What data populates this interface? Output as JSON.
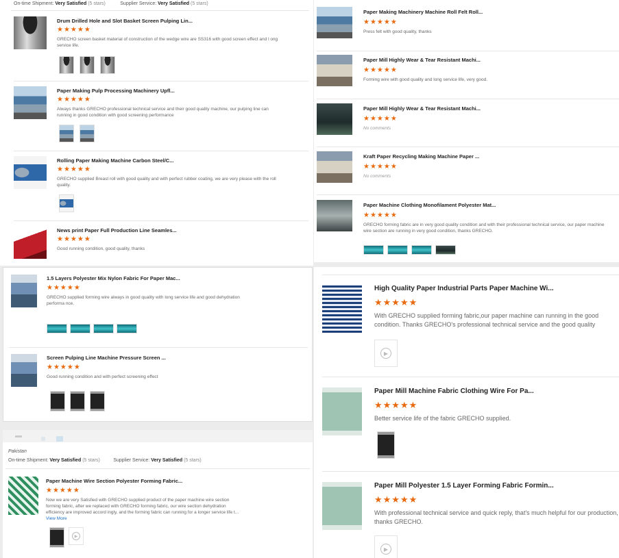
{
  "left_top": {
    "header": {
      "shipment_label": "On-time Shipment:",
      "shipment_value": "Very Satisfied",
      "shipment_stars": "(5 stars)",
      "service_label": "Supplier Service:",
      "service_value": "Very Satisfied",
      "service_stars": "(5 stars)"
    },
    "reviews": [
      {
        "title": "Drum Drilled Hole and Slot Basket Screen Pulping Lin...",
        "stars": "★★★★★",
        "text": "GRECHO screen basket material of construction of the wedge wire are SS316 with good screen effect and l ong service life.",
        "thumb_icon": "screen-basket-icon",
        "pics": [
          "basket-photo-icon",
          "basket-photo-icon",
          "basket-photo-icon"
        ]
      },
      {
        "title": "Paper Making Pulp Processing Machinery Upfl...",
        "stars": "★★★★★",
        "text": "Always thanks GRECHO professional technical service and their good quality machine, our pulping line can running in good condition with good screening performance",
        "thumb_icon": "pulping-machine-icon",
        "pics": [
          "machine-photo-icon",
          "machine-photo-icon"
        ]
      },
      {
        "title": "Rolling Paper Making Machine Carbon Steel/C...",
        "stars": "★★★★★",
        "text": "GRECHO supplied Breast roll with good quality and with perfect rubber coating, we are very please with the roll quality.",
        "thumb_icon": "breast-roll-icon",
        "pics": [
          "roll-photo-icon"
        ]
      },
      {
        "title": "News print Paper Full Production Line Seamles...",
        "stars": "★★★★★",
        "text": "Good running condition, good quality, thanks",
        "thumb_icon": "red-felt-icon",
        "pics": []
      }
    ]
  },
  "left_mid": {
    "reviews": [
      {
        "title": "1.5 Layers Polyester Mix Nylon Fabric For Paper Mac...",
        "stars": "★★★★★",
        "text": "GRECHO supplied forming wire always in good quality with long service life and good dehydration performa nce.",
        "thumb_icon": "forming-line-icon",
        "pics": [
          "fabric-photo-icon",
          "fabric-photo-icon",
          "fabric-photo-icon",
          "fabric-photo-icon"
        ]
      },
      {
        "title": "Screen Pulping Line Machine Pressure Screen ...",
        "stars": "★★★★★",
        "text": "Good running condition and with perfect screening effect",
        "thumb_icon": "pressure-screen-icon",
        "pics": [
          "screen-photo-icon",
          "screen-photo-icon",
          "screen-photo-icon"
        ]
      }
    ]
  },
  "left_bottom": {
    "country": "Pakistan",
    "header": {
      "shipment_label": "On-time Shipment:",
      "shipment_value": "Very Satisfied",
      "shipment_stars": "(5 stars)",
      "service_label": "Supplier Service:",
      "service_value": "Very Satisfied",
      "service_stars": "(5 stars)"
    },
    "review": {
      "title": "Paper Machine Wire Section Polyester Forming Fabric...",
      "stars": "★★★★★",
      "text": "Now we are very Satisfied with GRECHO supplied product of the paper machine wire section forming fabric, after we replaced with GRECHO forming fabric, our wire section dehydration efficiency are improved accord ingly, and the forming fabric can  running for a longer service life t...",
      "more": "View More",
      "thumb_icon": "forming-fabric-icon",
      "pics": [
        "wire-photo-icon"
      ],
      "play_icon": "play-icon"
    }
  },
  "right_top": {
    "reviews": [
      {
        "title": "Paper Making Machinery Machine Roll Felt Roll...",
        "stars": "★★★★★",
        "text": "Press felt with good quality, thanks",
        "thumb_icon": "press-felt-icon"
      },
      {
        "title": "Paper Mill Highly Wear & Tear Resistant Machi...",
        "stars": "★★★★★",
        "text": "Forming wire with good quality and long service life, very good.",
        "thumb_icon": "felt-roll-icon"
      },
      {
        "title": "Paper Mill Highly Wear & Tear Resistant Machi...",
        "stars": "★★★★★",
        "text": "No comments",
        "thumb_icon": "mill-hall-icon"
      },
      {
        "title": "Kraft Paper Recycling Making Machine Paper ...",
        "stars": "★★★★★",
        "text": "No comments",
        "thumb_icon": "paper-machine-icon"
      },
      {
        "title": "Paper Machine Clothing Monofilament Polyester Mat...",
        "stars": "★★★★★",
        "text": "GRECHO forming fabric are in very good quality condition and with their professional technical service, our paper machine wire section are running in very good condition, thanks GRECHO.",
        "thumb_icon": "clothing-machine-icon",
        "pics": [
          "fabric-photo-icon",
          "fabric-photo-icon",
          "fabric-photo-icon",
          "machine-photo-icon"
        ]
      }
    ]
  },
  "right_bottom": {
    "reviews": [
      {
        "title": "High Quality Paper Industrial Parts Paper Machine Wi...",
        "stars": "★★★★★",
        "text": "With GRECHO supplied forming fabric,our paper machine can running in the good condition. Thanks GRECHO's professional technical service and the good quality products.",
        "thumb_icon": "woven-fabric-icon",
        "play_icon": "play-icon"
      },
      {
        "title": "Paper Mill Machine Fabric Clothing Wire For Pa...",
        "stars": "★★★★★",
        "text": "Better service life of the fabric GRECHO supplied.",
        "thumb_icon": "fabric-roll-icon",
        "pics": [
          "wire-photo-icon"
        ]
      },
      {
        "title": "Paper Mill Polyester 1.5 Layer Forming Fabric Formin...",
        "stars": "★★★★★",
        "text": "With professional technical service and quick reply, that's much helpful for our production, thanks GRECHO.",
        "thumb_icon": "fabric-roll-icon",
        "play_icon": "play-icon"
      }
    ]
  }
}
